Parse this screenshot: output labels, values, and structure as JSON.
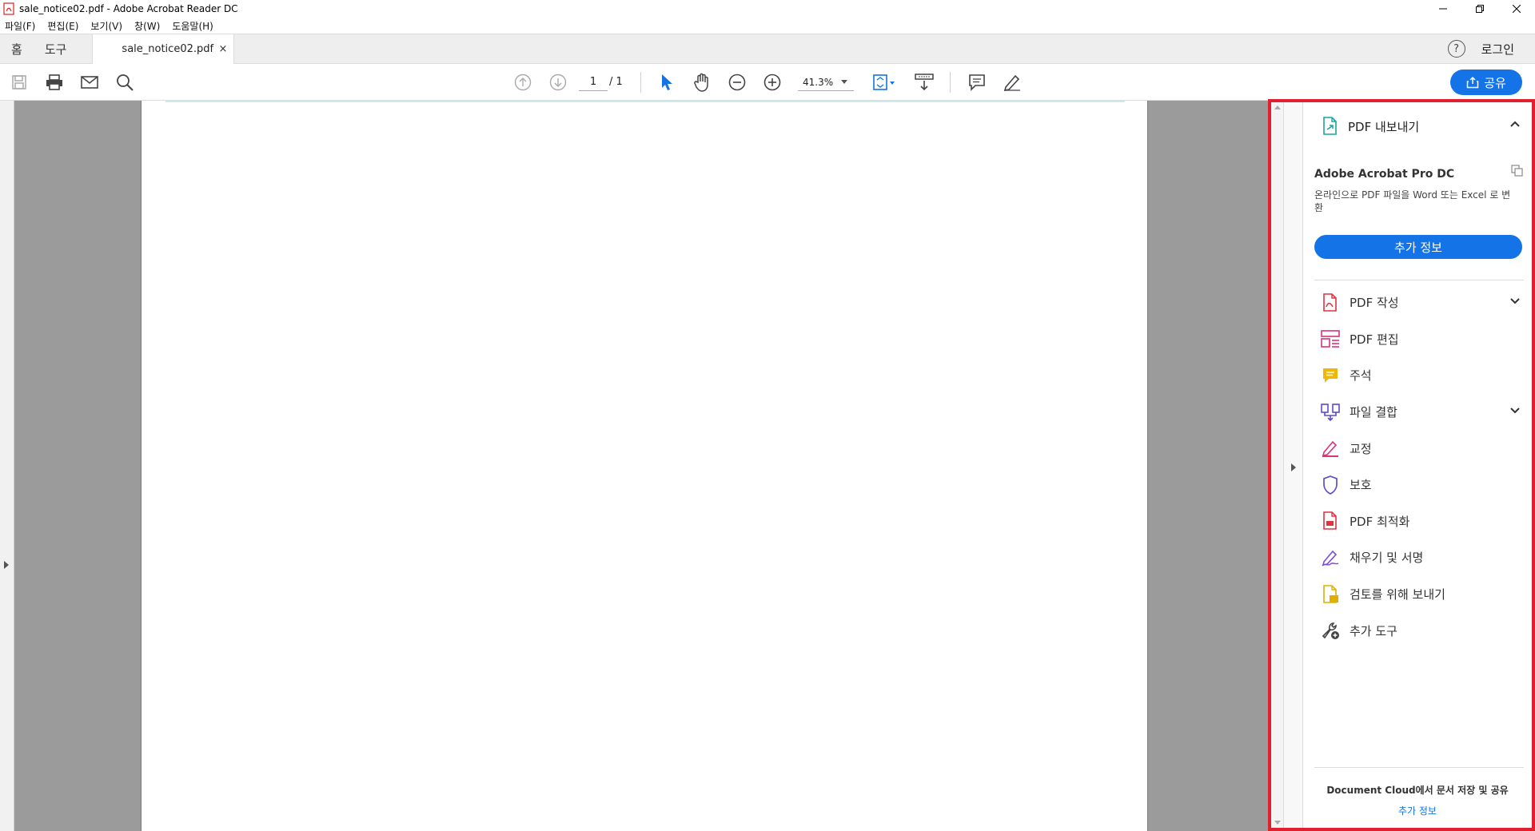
{
  "window": {
    "title": "sale_notice02.pdf - Adobe Acrobat Reader DC"
  },
  "menu": [
    "파일(F)",
    "편집(E)",
    "보기(V)",
    "창(W)",
    "도움말(H)"
  ],
  "tabs": {
    "home": "홈",
    "tools": "도구",
    "document": "sale_notice02.pdf",
    "close": "×",
    "login": "로그인",
    "help": "?"
  },
  "toolbar": {
    "page_current": "1",
    "page_total": "/ 1",
    "zoom": "41.3%",
    "share": "공유"
  },
  "pane": {
    "export_title": "PDF 내보내기",
    "promo_title": "Adobe Acrobat Pro DC",
    "promo_text": "온라인으로 PDF 파일을 Word 또는 Excel 로 변환",
    "promo_button": "추가 정보",
    "tools": [
      {
        "label": "PDF 작성",
        "icon": "create-pdf-icon",
        "expandable": true
      },
      {
        "label": "PDF 편집",
        "icon": "edit-pdf-icon",
        "expandable": false
      },
      {
        "label": "주석",
        "icon": "comment-icon",
        "expandable": false
      },
      {
        "label": "파일 결합",
        "icon": "combine-files-icon",
        "expandable": true
      },
      {
        "label": "교정",
        "icon": "redact-icon",
        "expandable": false
      },
      {
        "label": "보호",
        "icon": "protect-icon",
        "expandable": false
      },
      {
        "label": "PDF 최적화",
        "icon": "optimize-pdf-icon",
        "expandable": false
      },
      {
        "label": "채우기 및 서명",
        "icon": "fill-sign-icon",
        "expandable": false
      },
      {
        "label": "검토를 위해 보내기",
        "icon": "send-review-icon",
        "expandable": false
      },
      {
        "label": "추가 도구",
        "icon": "more-tools-icon",
        "expandable": false
      }
    ],
    "footer_text": "Document Cloud에서 문서 저장 및 공유",
    "footer_link": "추가 정보"
  },
  "colors": {
    "accent": "#1473e6",
    "highlight_frame": "#e0202e",
    "doc_background": "#9b9b9b"
  }
}
